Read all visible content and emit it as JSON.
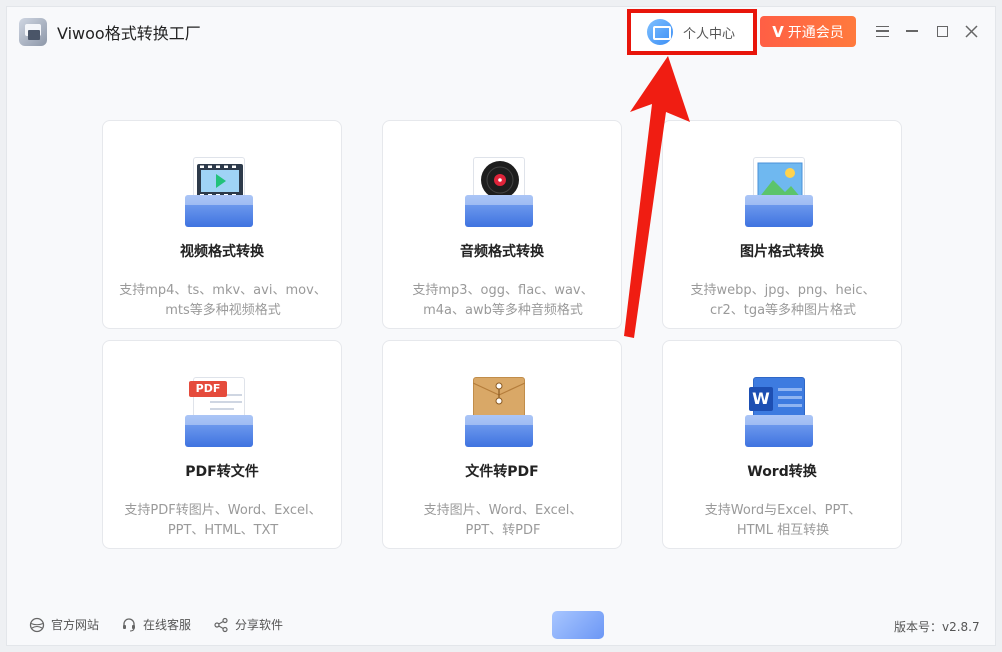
{
  "app": {
    "title": "Viwoo格式转换工厂"
  },
  "header": {
    "personal_center": "个人中心",
    "vip_mark": "V",
    "vip_label": "开通会员"
  },
  "colors": {
    "accent": "#3f73e0",
    "vip": "#ff6a3f",
    "highlight": "#e8150b"
  },
  "cards": [
    {
      "title": "视频格式转换",
      "desc_line1": "支持mp4、ts、mkv、avi、mov、",
      "desc_line2": "mts等多种视频格式",
      "icon": "video-file-icon"
    },
    {
      "title": "音频格式转换",
      "desc_line1": "支持mp3、ogg、flac、wav、",
      "desc_line2": "m4a、awb等多种音频格式",
      "icon": "audio-disc-icon"
    },
    {
      "title": "图片格式转换",
      "desc_line1": "支持webp、jpg、png、heic、",
      "desc_line2": "cr2、tga等多种图片格式",
      "icon": "image-file-icon"
    },
    {
      "title": "PDF转文件",
      "desc_line1": "支持PDF转图片、Word、Excel、",
      "desc_line2": "PPT、HTML、TXT",
      "icon": "pdf-file-icon",
      "badge": "PDF"
    },
    {
      "title": "文件转PDF",
      "desc_line1": "支持图片、Word、Excel、",
      "desc_line2": "PPT、转PDF",
      "icon": "envelope-file-icon"
    },
    {
      "title": "Word转换",
      "desc_line1": "支持Word与Excel、PPT、",
      "desc_line2": "HTML 相互转换",
      "icon": "word-file-icon",
      "badge": "W"
    }
  ],
  "footer": {
    "website": "官方网站",
    "support": "在线客服",
    "share": "分享软件",
    "version": "版本号：v2.8.7"
  }
}
